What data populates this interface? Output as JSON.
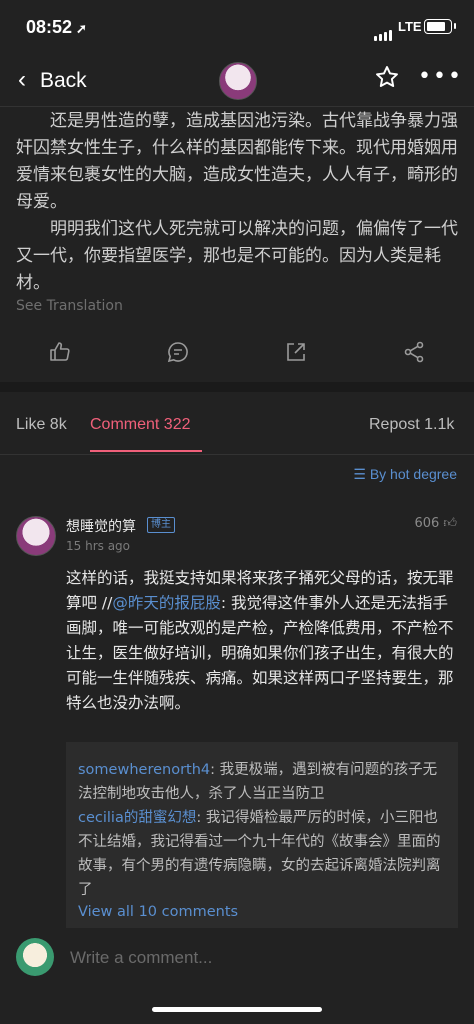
{
  "status_bar": {
    "time": "08:52",
    "network": "LTE"
  },
  "nav": {
    "back_label": "Back"
  },
  "post": {
    "paragraphs": [
      "还是男性造的孽，造成基因池污染。古代靠战争暴力强奸囚禁女性生子，什么样的基因都能传下来。现代用婚姻用爱情来包裹女性的大脑，造成女性造夫，人人有子，畸形的母爱。",
      "明明我们这代人死完就可以解决的问题，偏偏传了一代又一代，你要指望医学，那也是不可能的。因为人类是耗材。"
    ],
    "see_translation": "See Translation"
  },
  "tabs": {
    "like": "Like 8k",
    "comment": "Comment 322",
    "repost": "Repost 1.1k"
  },
  "sort": {
    "label": "By hot degree"
  },
  "comment": {
    "author": "想睡觉的算",
    "badge": "博主",
    "time": "15 hrs ago",
    "likes": "606",
    "body_before": "这样的话，我挺支持如果将来孩子捅死父母的话，按无罪算吧 //",
    "mention": "@昨天的报屁股",
    "body_after": ": 我觉得这件事外人还是无法指手画脚，唯一可能改观的是产检，产检降低费用，不产检不让生，医生做好培训，明确如果你们孩子出生，有很大的可能一生伴随残疾、病痛。如果这样两口子坚持要生，那特么也没办法啊。"
  },
  "replies": [
    {
      "name": "somewherenorth4",
      "text": ": 我更极端，遇到被有问题的孩子无法控制地攻击他人，杀了人当正当防卫"
    },
    {
      "name": "cecilia的甜蜜幻想",
      "text": ": 我记得婚检最严厉的时候，小三阳也不让结婚，我记得看过一个九十年代的《故事会》里面的故事，有个男的有遗传病隐瞒，女的去起诉离婚法院判离了"
    }
  ],
  "view_all": "View all 10 comments",
  "composer": {
    "placeholder": "Write a comment..."
  },
  "colors": {
    "accent": "#f0607a",
    "link": "#5a8fd0",
    "background": "#222222"
  },
  "icons": [
    "location-arrow-icon",
    "signal-icon",
    "battery-icon",
    "chevron-left-icon",
    "star-icon",
    "more-icon",
    "like-icon",
    "comment-icon",
    "share-icon",
    "repost-icon",
    "sort-icon",
    "thumb-up-icon"
  ]
}
